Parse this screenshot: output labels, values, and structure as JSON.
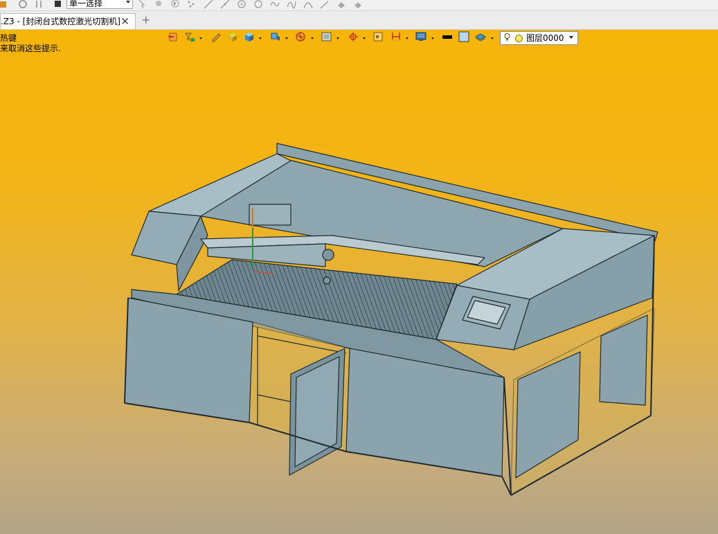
{
  "toolbar": {
    "selection_mode": "单一选择"
  },
  "tabs": [
    {
      "title": ".Z3 - [封闭台式数控激光切割机]",
      "close_icon": "close-icon"
    }
  ],
  "new_tab_label": "+",
  "hints": {
    "line1": "热键",
    "line2": "来取消这些提示."
  },
  "layer": {
    "current": "图层0000"
  },
  "colors": {
    "viewport_top": "#f7b50a",
    "viewport_bottom": "#b3a487",
    "model_panel": "#8fa9b2",
    "model_edge": "#1f2a2e",
    "panel_light": "#a6bcc4"
  },
  "icons": [
    "undo-icon",
    "redo-icon",
    "stop-icon",
    "select-pointer-icon",
    "point-icon",
    "play-icon",
    "line-icon",
    "arc-icon",
    "circle-icon",
    "curve-icon",
    "spline-icon",
    "bridge-icon",
    "orange-export-icon",
    "layer-filter-icon",
    "pencil-icon",
    "box-face-icon",
    "cube-icon",
    "shaded-cube-icon",
    "render-sphere-icon",
    "view-frame-icon",
    "crosshair-icon",
    "square-icon",
    "dimension-icon",
    "display-icon",
    "black-color-icon",
    "light-blue-color-icon",
    "layer-stack-icon",
    "lightbulb-icon"
  ]
}
